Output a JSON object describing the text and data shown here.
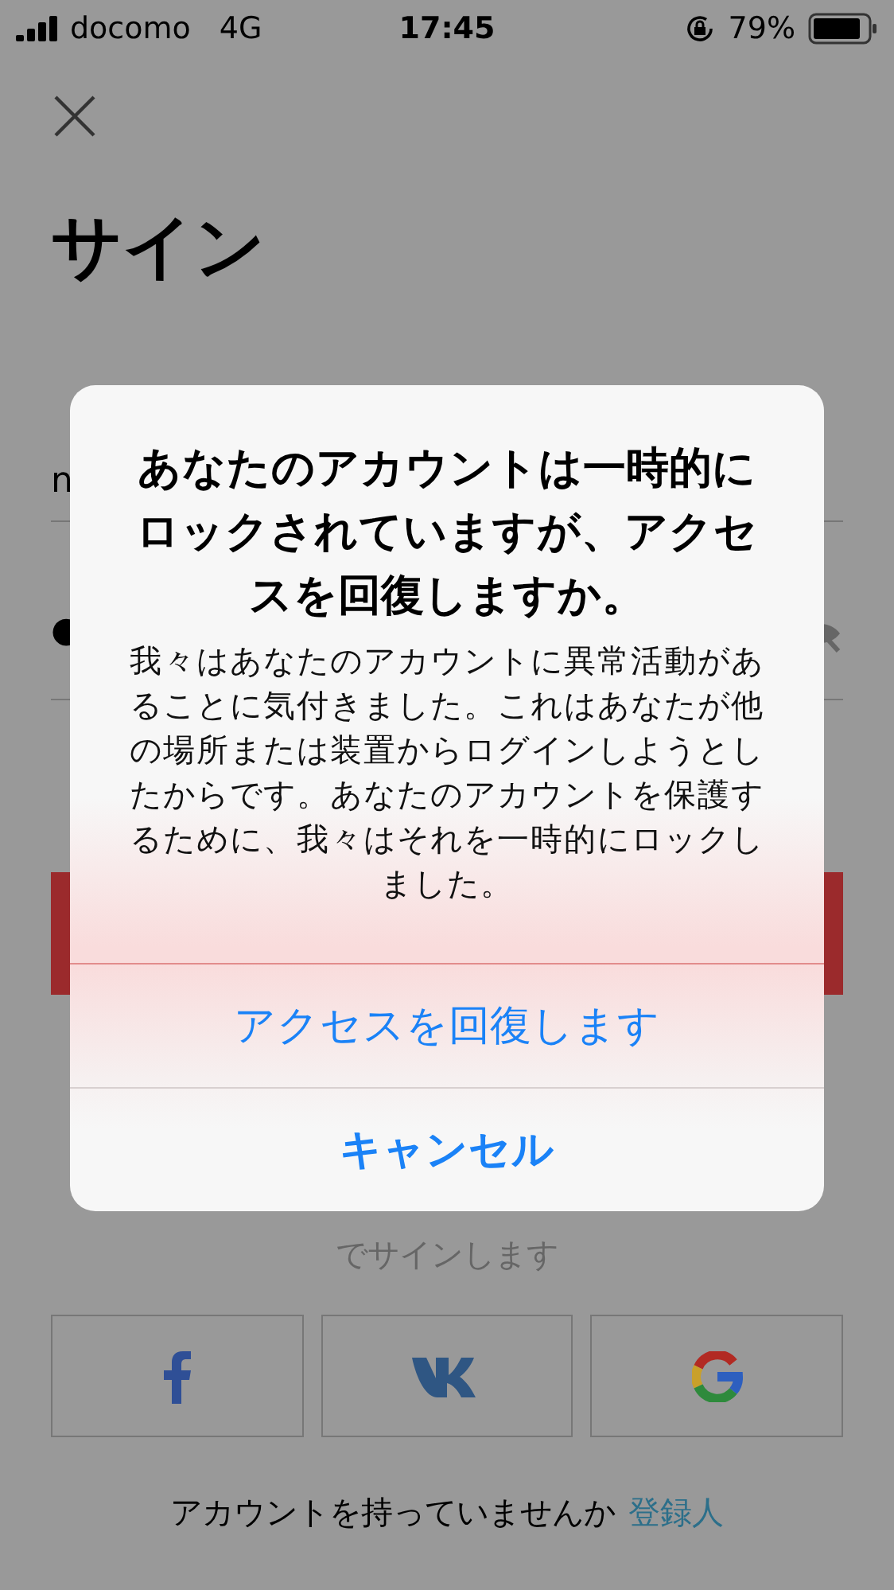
{
  "status_bar": {
    "carrier": "docomo",
    "network": "4G",
    "time": "17:45",
    "battery": "79%"
  },
  "page": {
    "title": "サイン",
    "username_field": {
      "value": "n"
    },
    "password_field": {
      "value": "●"
    },
    "social_prompt": "でサインします",
    "social_buttons": [
      {
        "kind": "facebook"
      },
      {
        "kind": "vk"
      },
      {
        "kind": "google"
      }
    ],
    "signup_prompt": {
      "text": "アカウントを持っていませんか",
      "link": "登録人"
    }
  },
  "dialog": {
    "title": "あなたのアカウントは一時的にロックされていますが、アクセスを回復しますか。",
    "message": "我々はあなたのアカウントに異常活動があることに気付きました。これはあなたが他の場所または装置からログインしようとしたからです。あなたのアカウントを保護するために、我々はそれを一時的にロックしました。",
    "actions": [
      {
        "label": "アクセスを回復します",
        "kind": "default"
      },
      {
        "label": "キャンセル",
        "kind": "cancel"
      }
    ]
  }
}
